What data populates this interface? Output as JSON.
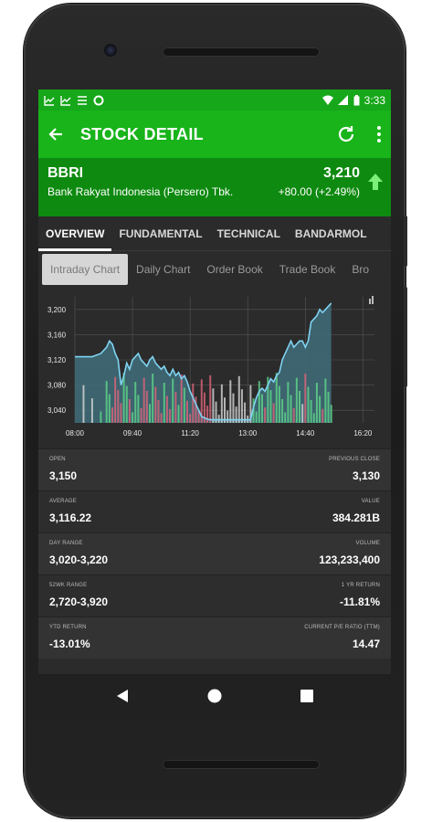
{
  "status": {
    "time": "3:33"
  },
  "appbar": {
    "title": "STOCK DETAIL"
  },
  "stock": {
    "ticker": "BBRI",
    "company": "Bank Rakyat Indonesia (Persero) Tbk.",
    "price": "3,210",
    "change": "+80.00 (+2.49%)"
  },
  "tabs": [
    {
      "label": "OVERVIEW"
    },
    {
      "label": "FUNDAMENTAL"
    },
    {
      "label": "TECHNICAL"
    },
    {
      "label": "BANDARMOL"
    }
  ],
  "subtabs": [
    {
      "label": "Intraday Chart"
    },
    {
      "label": "Daily Chart"
    },
    {
      "label": "Order Book"
    },
    {
      "label": "Trade Book"
    },
    {
      "label": "Bro"
    }
  ],
  "chart_data": {
    "type": "area",
    "y_ticks": [
      "3,200",
      "3,160",
      "3,120",
      "3,080",
      "3,040"
    ],
    "y_values": [
      3200,
      3160,
      3120,
      3080,
      3040
    ],
    "ylim": [
      3020,
      3220
    ],
    "x_ticks": [
      "08:00",
      "09:40",
      "11:20",
      "13:00",
      "14:40",
      "16:20"
    ],
    "x_minutes": [
      480,
      580,
      680,
      780,
      880,
      980
    ],
    "xlim": [
      480,
      1000
    ],
    "series": [
      {
        "times": [
          480,
          495,
          510,
          525,
          535,
          540,
          545,
          550,
          555,
          560,
          565,
          570,
          575,
          580,
          585,
          590,
          595,
          600,
          605,
          610,
          615,
          620,
          625,
          630,
          635,
          640,
          645,
          650,
          655,
          660,
          665,
          670,
          675,
          680,
          685,
          690,
          695,
          700,
          705,
          710,
          715,
          720,
          725,
          730,
          735,
          740,
          745,
          750,
          755,
          760,
          765,
          770,
          775,
          780,
          785,
          790,
          795,
          800,
          805,
          810,
          815,
          820,
          825,
          830,
          835,
          840,
          845,
          850,
          855,
          860,
          865,
          870,
          875,
          880,
          885,
          890,
          895,
          900,
          905,
          910,
          915,
          920,
          925
        ],
        "values": [
          3125,
          3125,
          3125,
          3130,
          3140,
          3150,
          3145,
          3130,
          3120,
          3080,
          3095,
          3115,
          3105,
          3120,
          3125,
          3130,
          3120,
          3115,
          3110,
          3120,
          3125,
          3115,
          3110,
          3105,
          3110,
          3100,
          3095,
          3105,
          3095,
          3100,
          3090,
          3095,
          3085,
          3070,
          3060,
          3050,
          3040,
          3030,
          3028,
          3026,
          3025,
          3025,
          3025,
          3025,
          3025,
          3025,
          3025,
          3025,
          3025,
          3025,
          3025,
          3025,
          3025,
          3025,
          3025,
          3045,
          3060,
          3070,
          3075,
          3070,
          3080,
          3090,
          3085,
          3095,
          3100,
          3120,
          3130,
          3140,
          3150,
          3140,
          3145,
          3150,
          3150,
          3140,
          3150,
          3180,
          3185,
          3190,
          3200,
          3195,
          3200,
          3205,
          3210
        ]
      }
    ],
    "volume_colors": {
      "up": "#5fd68a",
      "down": "#e0647a",
      "flat": "#d6d6d6"
    },
    "line_color": "#7fd3f2",
    "fill_color": "#3f6d7a"
  },
  "stats": [
    {
      "left_label": "OPEN",
      "left_value": "3,150",
      "right_label": "PREVIOUS CLOSE",
      "right_value": "3,130"
    },
    {
      "left_label": "AVERAGE",
      "left_value": "3,116.22",
      "right_label": "VALUE",
      "right_value": "384.281B"
    },
    {
      "left_label": "DAY RANGE",
      "left_value": "3,020-3,220",
      "right_label": "VOLUME",
      "right_value": "123,233,400"
    },
    {
      "left_label": "52WK RANGE",
      "left_value": "2,720-3,920",
      "right_label": "1 YR RETURN",
      "right_value": "-11.81%"
    },
    {
      "left_label": "YTD RETURN",
      "left_value": "-13.01%",
      "right_label": "CURRENT P/E RATIO (TTM)",
      "right_value": "14.47"
    }
  ],
  "colors": {
    "appbar": "#18b41a",
    "statusbar": "#17a71a",
    "header": "#0e8a10",
    "background": "#2b2b2b"
  }
}
